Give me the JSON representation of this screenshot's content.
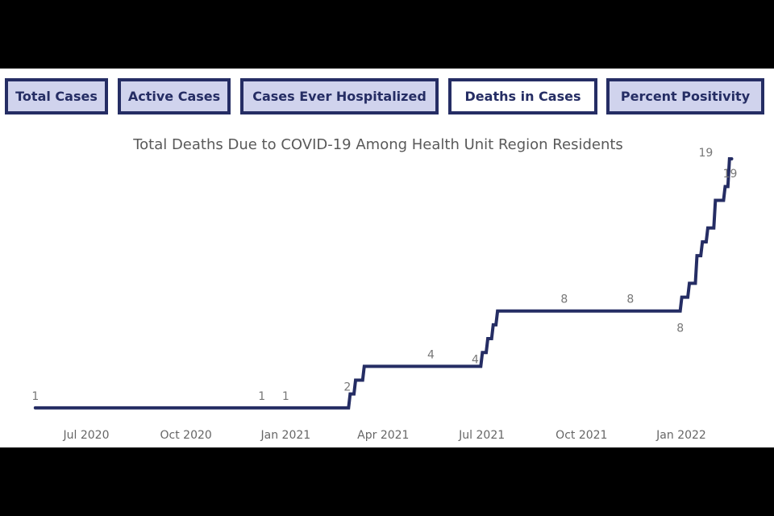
{
  "tabs": [
    {
      "label": "Total Cases",
      "active": false
    },
    {
      "label": "Active Cases",
      "active": false
    },
    {
      "label": "Cases Ever Hospitalized",
      "active": false
    },
    {
      "label": "Deaths in Cases",
      "active": true
    },
    {
      "label": "Percent Positivity",
      "active": false
    }
  ],
  "colors": {
    "line": "#252d64",
    "tab_bg": "#d0d3ed",
    "tab_border": "#252d64"
  },
  "chart_data": {
    "type": "line",
    "step": true,
    "title": "Total Deaths Due to COVID-19 Among Health Unit Region Residents",
    "xlabel": "",
    "ylabel": "",
    "x_ticks": [
      "Jul 2020",
      "Oct 2020",
      "Jan 2021",
      "Apr 2021",
      "Jul 2021",
      "Oct 2021",
      "Jan 2022"
    ],
    "x_tick_dates": [
      "2020-07-01",
      "2020-10-01",
      "2021-01-01",
      "2021-04-01",
      "2021-07-01",
      "2021-10-01",
      "2022-01-01"
    ],
    "x_range": [
      "2020-05-15",
      "2022-02-15"
    ],
    "ylim": [
      0,
      20
    ],
    "grid": false,
    "legend": "none",
    "series": [
      {
        "name": "Total Deaths",
        "points": [
          {
            "date": "2020-05-15",
            "value": 1
          },
          {
            "date": "2021-02-28",
            "value": 2
          },
          {
            "date": "2021-03-05",
            "value": 3
          },
          {
            "date": "2021-03-13",
            "value": 4
          },
          {
            "date": "2021-06-30",
            "value": 5
          },
          {
            "date": "2021-07-05",
            "value": 6
          },
          {
            "date": "2021-07-10",
            "value": 7
          },
          {
            "date": "2021-07-14",
            "value": 8
          },
          {
            "date": "2021-12-31",
            "value": 9
          },
          {
            "date": "2022-01-07",
            "value": 10
          },
          {
            "date": "2022-01-14",
            "value": 12
          },
          {
            "date": "2022-01-19",
            "value": 13
          },
          {
            "date": "2022-01-24",
            "value": 14
          },
          {
            "date": "2022-01-31",
            "value": 16
          },
          {
            "date": "2022-02-09",
            "value": 17
          },
          {
            "date": "2022-02-13",
            "value": 19
          },
          {
            "date": "2022-02-15",
            "value": 19
          }
        ]
      }
    ],
    "data_labels": [
      {
        "date": "2020-05-15",
        "value": 1,
        "text": "1",
        "pos": "above"
      },
      {
        "date": "2020-12-10",
        "value": 1,
        "text": "1",
        "pos": "above"
      },
      {
        "date": "2021-01-01",
        "value": 1,
        "text": "1",
        "pos": "above"
      },
      {
        "date": "2021-03-03",
        "value": 2,
        "text": "2",
        "pos": "left"
      },
      {
        "date": "2021-05-15",
        "value": 4,
        "text": "4",
        "pos": "above"
      },
      {
        "date": "2021-06-29",
        "value": 4,
        "text": "4",
        "pos": "left"
      },
      {
        "date": "2021-09-15",
        "value": 8,
        "text": "8",
        "pos": "above"
      },
      {
        "date": "2021-11-15",
        "value": 8,
        "text": "8",
        "pos": "above"
      },
      {
        "date": "2021-12-31",
        "value": 8,
        "text": "8",
        "pos": "below"
      },
      {
        "date": "2022-02-03",
        "value": 19,
        "text": "19",
        "pos": "above"
      },
      {
        "date": "2022-02-15",
        "value": 19,
        "text": "19",
        "pos": "below"
      }
    ]
  }
}
